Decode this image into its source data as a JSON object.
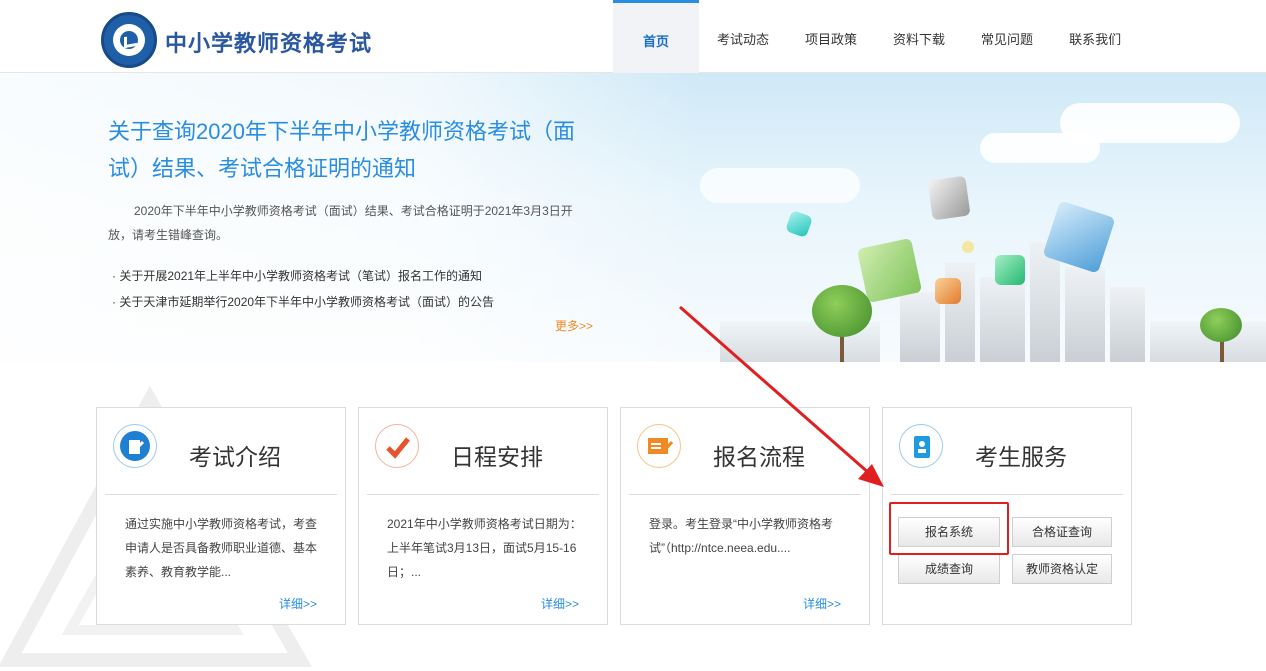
{
  "header": {
    "site_title": "中小学教师资格考试",
    "nav": [
      "首页",
      "考试动态",
      "项目政策",
      "资料下载",
      "常见问题",
      "联系我们"
    ],
    "active_index": 0
  },
  "banner": {
    "title": "关于查询2020年下半年中小学教师资格考试（面试）结果、考试合格证明的通知",
    "summary": "2020年下半年中小学教师资格考试（面试）结果、考试合格证明于2021年3月3日开放，请考生错峰查询。",
    "news": [
      "关于开展2021年上半年中小学教师资格考试（笔试）报名工作的通知",
      "关于天津市延期举行2020年下半年中小学教师资格考试（面试）的公告"
    ],
    "more": "更多>>"
  },
  "cards": [
    {
      "title": "考试介绍",
      "desc": "通过实施中小学教师资格考试，考查申请人是否具备教师职业道德、基本素养、教育教学能...",
      "more": "详细>>",
      "icon": "exam-document-icon"
    },
    {
      "title": "日程安排",
      "desc": "2021年中小学教师资格考试日期为：上半年笔试3月13日，面试5月15-16日；...",
      "more": "详细>>",
      "icon": "checkmark-icon"
    },
    {
      "title": "报名流程",
      "desc": "登录。考生登录“中小学教师资格考试”（http://ntce.neea.edu....",
      "more": "详细>>",
      "icon": "registration-form-icon"
    }
  ],
  "services": {
    "title": "考生服务",
    "icon": "address-book-icon",
    "buttons": [
      "报名系统",
      "合格证查询",
      "成绩查询",
      "教师资格认定"
    ]
  },
  "colors": {
    "brand_blue": "#2a57a0",
    "link_blue": "#2a8de0",
    "orange": "#f08a24",
    "annotation_red": "#e02020"
  }
}
